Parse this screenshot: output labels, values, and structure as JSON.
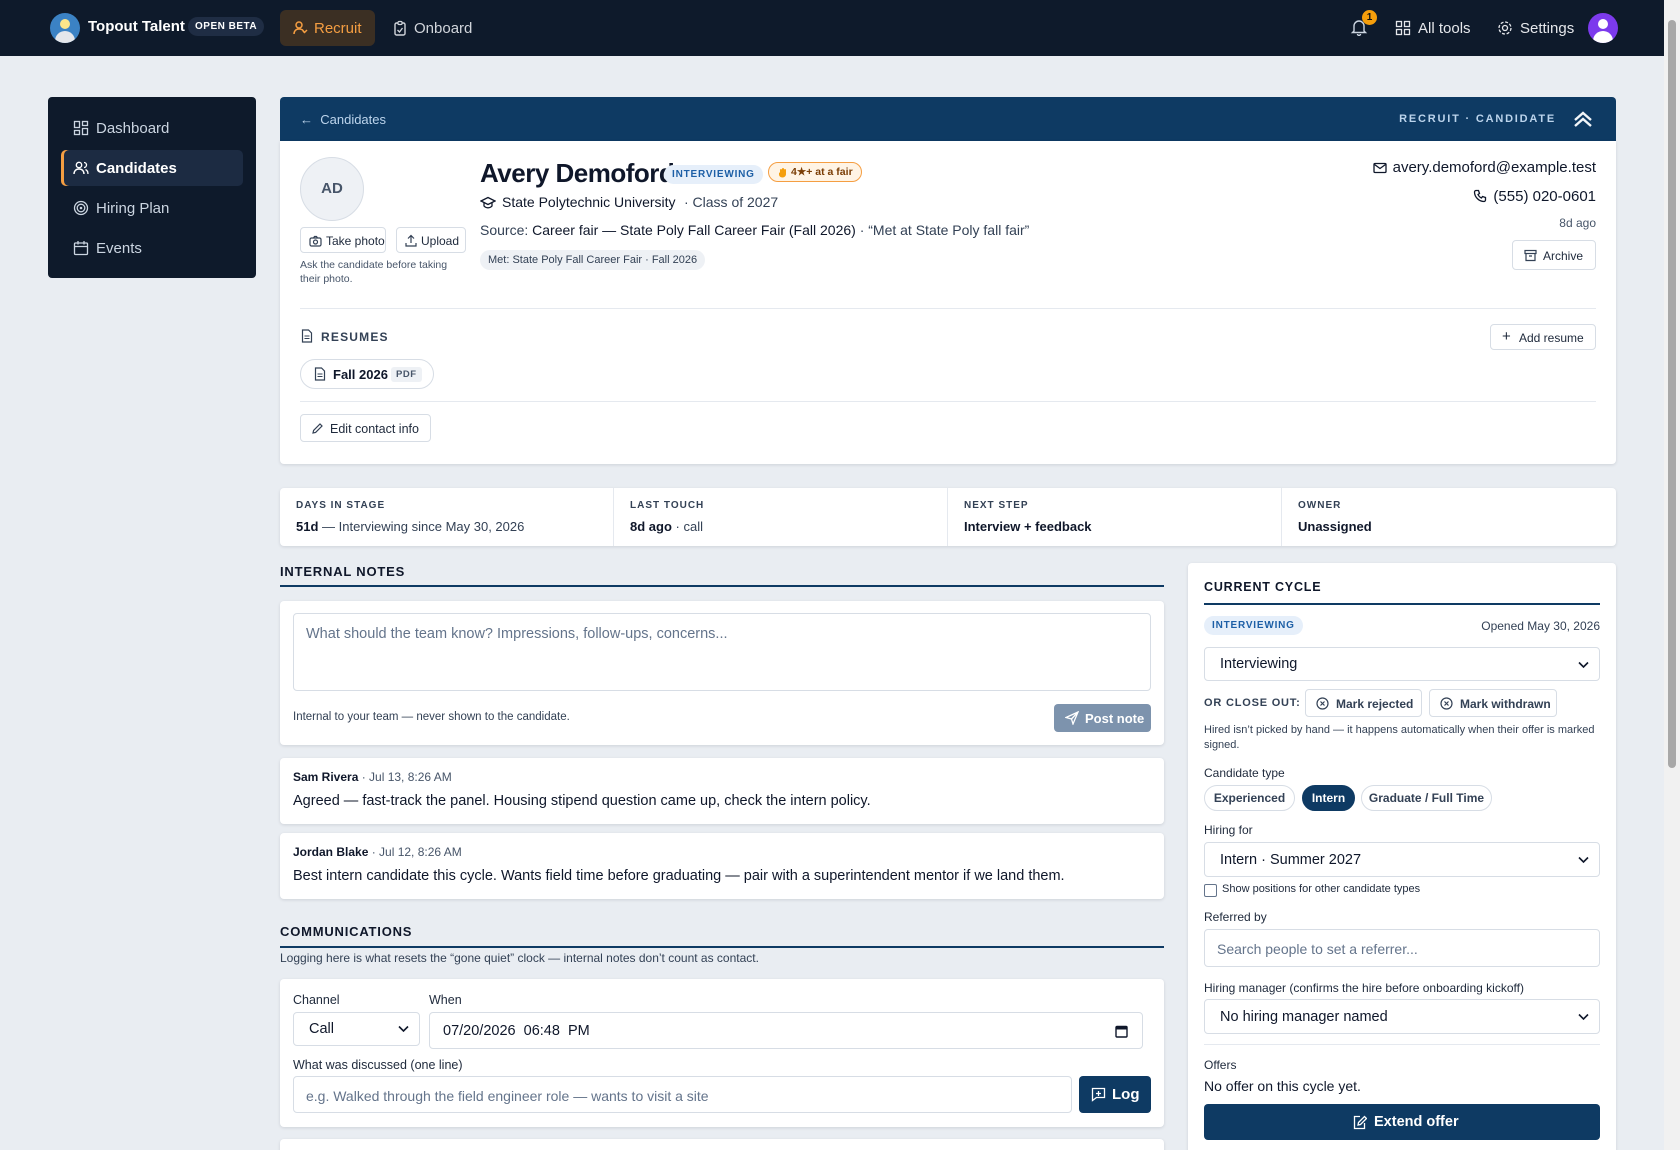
{
  "topbar": {
    "brand": "Topout Talent",
    "beta_badge": "OPEN BETA",
    "nav": [
      {
        "label": "Recruit",
        "active": true
      },
      {
        "label": "Onboard",
        "active": false
      }
    ],
    "notification_count": "1",
    "all_tools": "All tools",
    "settings": "Settings"
  },
  "sidebar": {
    "items": [
      {
        "label": "Dashboard",
        "icon": "dashboard-icon"
      },
      {
        "label": "Candidates",
        "icon": "users-icon",
        "active": true
      },
      {
        "label": "Hiring Plan",
        "icon": "target-icon"
      },
      {
        "label": "Events",
        "icon": "calendar-icon"
      }
    ]
  },
  "header": {
    "back": "Candidates",
    "crumb": "RECRUIT · CANDIDATE"
  },
  "profile": {
    "initials": "AD",
    "take_photo": "Take photo",
    "upload": "Upload",
    "photo_hint": "Ask the candidate before taking their photo.",
    "name": "Avery Demoford",
    "status": "INTERVIEWING",
    "fair_badge": "4★+ at a fair",
    "school": "State Polytechnic University",
    "class_of": "· Class of 2027",
    "source_prefix": "Source:",
    "source_value": "Career fair — State Poly Fall Career Fair (Fall 2026)",
    "source_quote": "· “Met at State Poly fall fair”",
    "met_tag": "Met: State Poly Fall Career Fair · Fall 2026",
    "email": "avery.demoford@example.test",
    "phone": "(555) 020-0601",
    "ago": "8d ago",
    "archive": "Archive",
    "resumes_label": "RESUMES",
    "add_resume": "Add resume",
    "resume_name": "Fall 2026",
    "resume_type": "PDF",
    "edit_contact": "Edit contact info"
  },
  "stats": [
    {
      "key": "DAYS IN STAGE",
      "value": "51d",
      "detail": " — Interviewing since May 30, 2026"
    },
    {
      "key": "LAST TOUCH",
      "value": "8d ago",
      "detail": " · call"
    },
    {
      "key": "NEXT STEP",
      "value": "Interview + feedback",
      "detail": ""
    },
    {
      "key": "OWNER",
      "value": "Unassigned",
      "detail": ""
    }
  ],
  "notes": {
    "title": "INTERNAL NOTES",
    "placeholder": "What should the team know? Impressions, follow-ups, concerns...",
    "visibility": "Internal to your team — never shown to the candidate.",
    "post": "Post note",
    "items": [
      {
        "author": "Sam Rivera",
        "time": " · Jul 13, 8:26 AM",
        "text": "Agreed — fast-track the panel. Housing stipend question came up, check the intern policy."
      },
      {
        "author": "Jordan Blake",
        "time": " · Jul 12, 8:26 AM",
        "text": "Best intern candidate this cycle. Wants field time before graduating — pair with a superintendent mentor if we land them."
      }
    ]
  },
  "comms": {
    "title": "COMMUNICATIONS",
    "subtitle": "Logging here is what resets the “gone quiet” clock — internal notes don’t count as contact.",
    "channel_label": "Channel",
    "channel_value": "Call",
    "when_label": "When",
    "when_value": "07/20/2026  06:48  PM",
    "discussed_label": "What was discussed (one line)",
    "discussed_placeholder": "e.g. Walked through the field engineer role — wants to visit a site",
    "log": "Log"
  },
  "cycle": {
    "title": "CURRENT CYCLE",
    "status": "INTERVIEWING",
    "opened": "Opened May 30, 2026",
    "stage_value": "Interviewing",
    "close_out_label": "OR CLOSE OUT:",
    "mark_rejected": "Mark rejected",
    "mark_withdrawn": "Mark withdrawn",
    "hired_note": "Hired isn’t picked by hand — it happens automatically when their offer is marked signed.",
    "type_label": "Candidate type",
    "types": [
      "Experienced",
      "Intern",
      "Graduate / Full Time"
    ],
    "type_selected": "Intern",
    "hiring_for_label": "Hiring for",
    "hiring_for_value": "Intern · Summer 2027",
    "show_other": "Show positions for other candidate types",
    "referred_label": "Referred by",
    "referred_placeholder": "Search people to set a referrer...",
    "manager_label": "Hiring manager (confirms the hire before onboarding kickoff)",
    "manager_value": "No hiring manager named",
    "offers_label": "Offers",
    "offers_value": "No offer on this cycle yet.",
    "extend": "Extend offer"
  }
}
